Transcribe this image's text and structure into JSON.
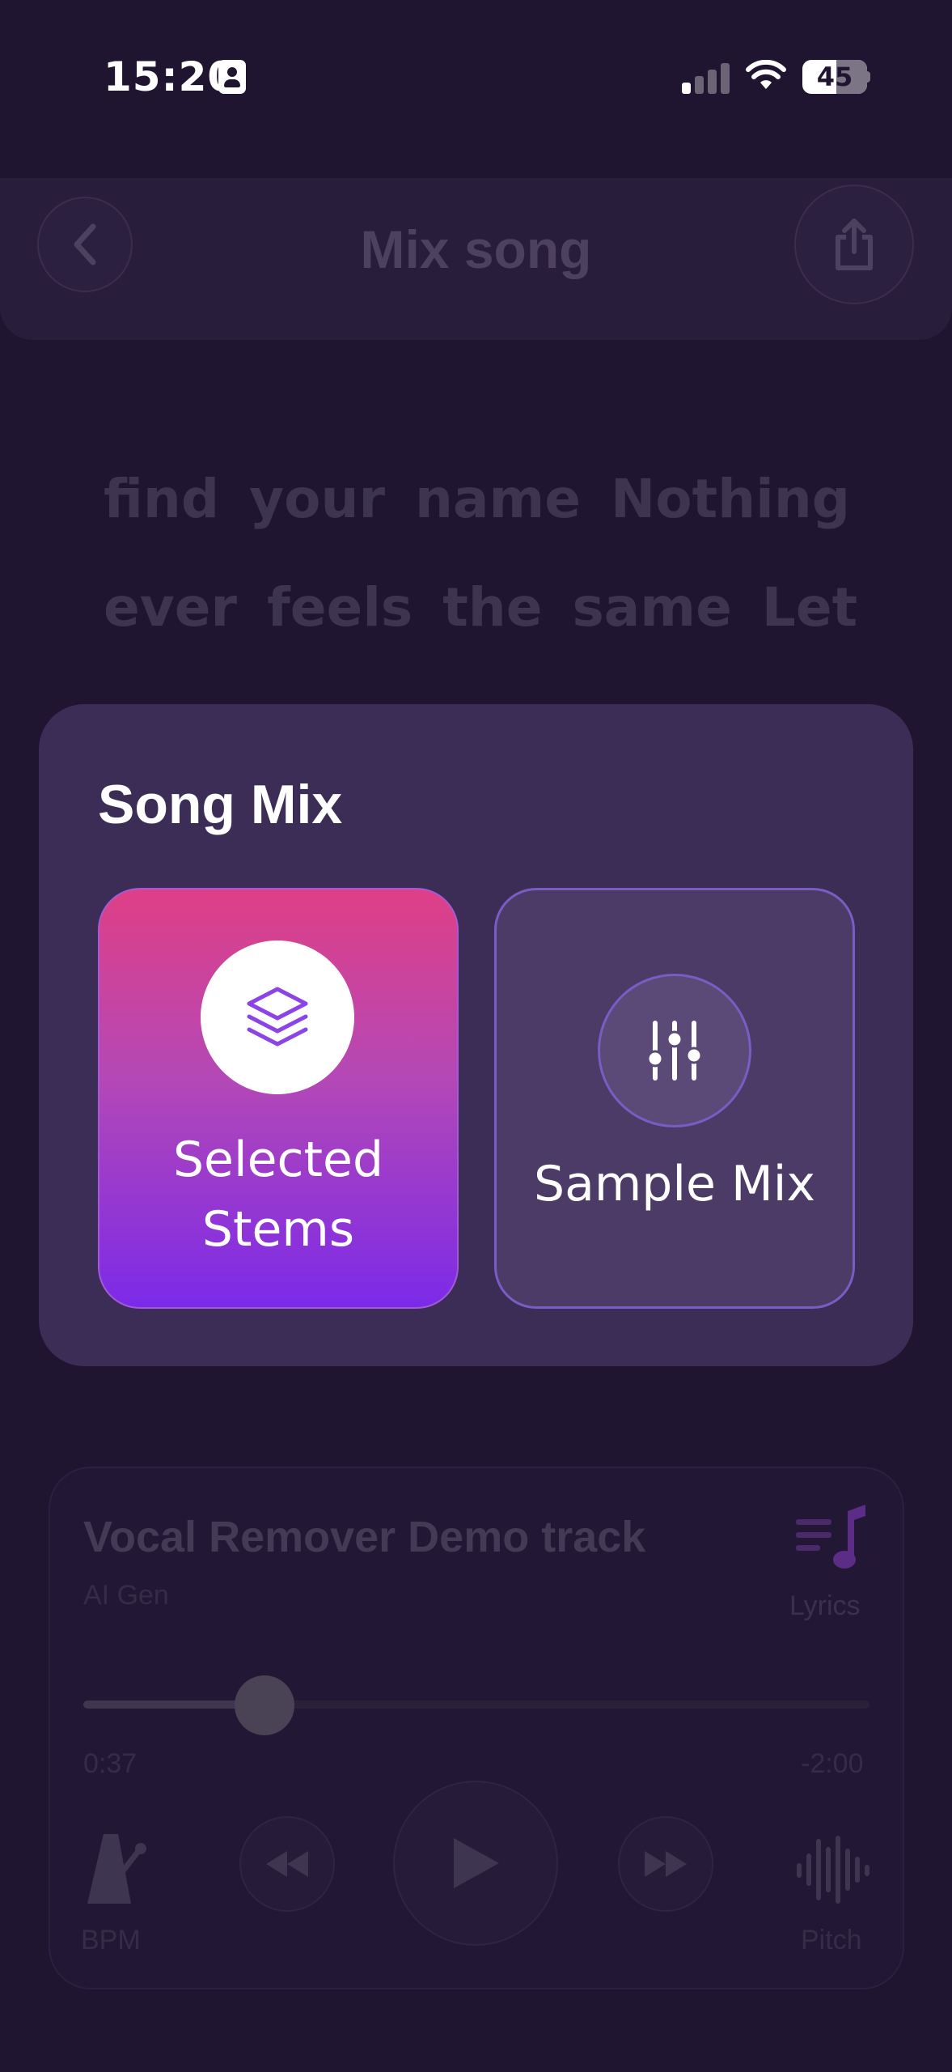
{
  "status_bar": {
    "time": "15:20",
    "battery": "45"
  },
  "header": {
    "title": "Mix song"
  },
  "lyrics": {
    "lines": [
      "find your name Nothing",
      "ever feels the same Let"
    ]
  },
  "player": {
    "track_title": "Vocal Remover Demo track",
    "artist": "AI Gen",
    "lyrics_label": "Lyrics",
    "elapsed": "0:37",
    "remaining": "-2:00",
    "progress_fraction": 0.23,
    "bpm_label": "BPM",
    "pitch_label": "Pitch"
  },
  "modal": {
    "title": "Song Mix",
    "options": [
      {
        "label_line1": "Selected",
        "label_line2": "Stems",
        "icon": "stack-layers-icon",
        "selected": true
      },
      {
        "label": "Sample Mix",
        "icon": "sliders-icon",
        "selected": false
      }
    ]
  },
  "colors": {
    "background": "#1f1530",
    "modal": "#3c2d56",
    "selected_gradient_top": "#df3f86",
    "selected_gradient_bottom": "#7b2ae8",
    "unselected_card": "#4b3b66",
    "accent_border": "#7a5cc4"
  }
}
